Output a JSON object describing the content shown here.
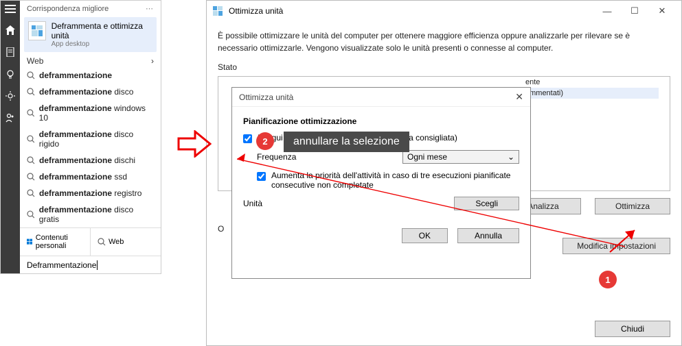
{
  "search": {
    "header": "Corrispondenza migliore",
    "best_match_title": "Deframmenta e ottimizza unità",
    "best_match_sub": "App desktop",
    "web_label": "Web",
    "suggestions": [
      "deframmentazione",
      "deframmentazione disco",
      "deframmentazione windows 10",
      "deframmentazione disco rigido",
      "deframmentazione dischi",
      "deframmentazione ssd",
      "deframmentazione registro",
      "deframmentazione disco gratis"
    ],
    "tab_personal": "Contenuti personali",
    "tab_web": "Web",
    "input_value": "Deframmentazione"
  },
  "main": {
    "title": "Ottimizza unità",
    "desc": "È possibile ottimizzare le unità del computer per ottenere maggiore efficienza oppure analizzarle per rilevare se è necessario ottimizzarle. Vengono visualizzate solo le unità presenti o connesse al computer.",
    "stato": "Stato",
    "col_frag_head": "ente",
    "col_frag_val": "ammentati)",
    "analizza": "Analizza",
    "ottimizza": "Ottimizza",
    "opt_section": "O",
    "modifica": "Modifica impostazioni",
    "chiudi": "Chiudi"
  },
  "dialog": {
    "title": "Ottimizza unità",
    "group": "Pianificazione ottimizzazione",
    "cb1": "Esegui in base a una pianificazione (scelta consigliata)",
    "freq_label": "Frequenza",
    "freq_value": "Ogni mese",
    "cb2": "Aumenta la priorità dell'attività in caso di tre esecuzioni pianificate consecutive non completate",
    "unita": "Unità",
    "scegli": "Scegli",
    "ok": "OK",
    "annulla": "Annulla"
  },
  "anno": {
    "tooltip": "annullare la selezione",
    "b1": "1",
    "b2": "2"
  }
}
